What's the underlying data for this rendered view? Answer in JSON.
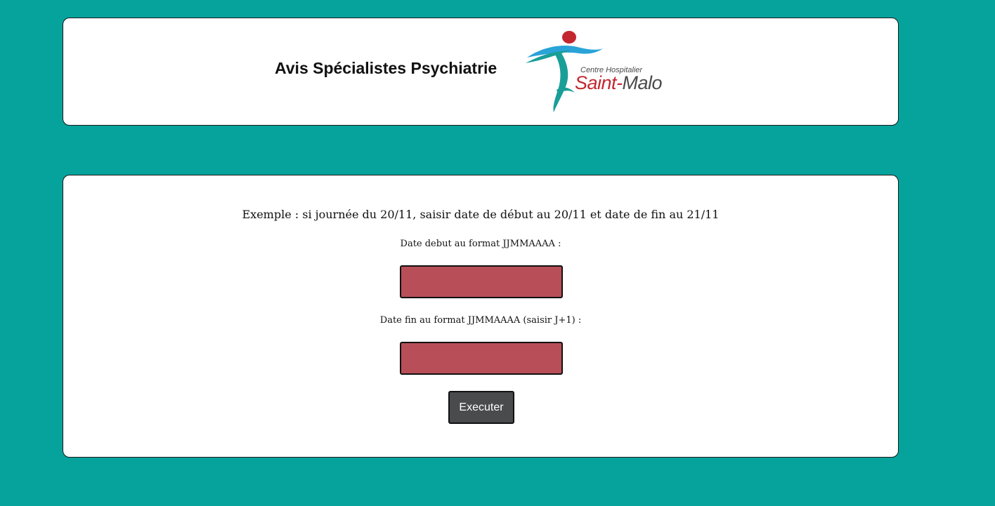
{
  "header": {
    "title": "Avis Spécialistes Psychiatrie",
    "logo": {
      "line1": "Centre Hospitalier",
      "line2_part1": "Saint-",
      "line2_part2": "Malo",
      "icon": "hospital-figure-logo",
      "colors": {
        "teal": "#1a9e98",
        "blue": "#29a3d8",
        "red": "#c3272f",
        "grey": "#4a4a4a"
      }
    }
  },
  "form": {
    "example_text": "Exemple : si journée du 20/11, saisir date de début au 20/11 et date de fin au 21/11",
    "start_label": "Date debut au format JJMMAAAA :",
    "start_value": "",
    "end_label": "Date fin au format JJMMAAAA (saisir J+1) :",
    "end_value": "",
    "submit_label": "Executer"
  },
  "colors": {
    "background": "#05a39c",
    "card": "#ffffff",
    "input_fill": "#b84f58",
    "button_fill": "#4a4b4d"
  }
}
